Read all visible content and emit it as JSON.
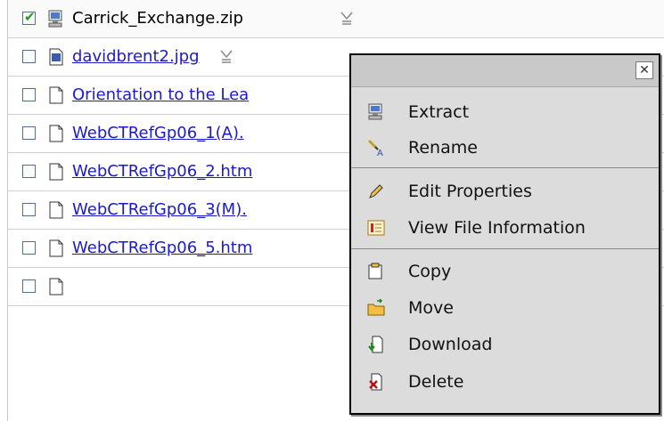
{
  "files": [
    {
      "name": "Carrick_Exchange.zip",
      "icon": "zip-archive-icon",
      "link": false,
      "checked": true
    },
    {
      "name": "davidbrent2.jpg",
      "icon": "image-file-icon",
      "link": true,
      "checked": false
    },
    {
      "name": "Orientation to the Lea",
      "icon": "document-icon",
      "link": true,
      "checked": false
    },
    {
      "name": "WebCTRefGp06_1(A).",
      "icon": "document-icon",
      "link": true,
      "checked": false
    },
    {
      "name": "WebCTRefGp06_2.htm",
      "icon": "document-icon",
      "link": true,
      "checked": false
    },
    {
      "name": "WebCTRefGp06_3(M).",
      "icon": "document-icon",
      "link": true,
      "checked": false
    },
    {
      "name": "WebCTRefGp06_5.htm",
      "icon": "document-icon",
      "link": true,
      "checked": false
    }
  ],
  "context_menu": {
    "close_label": "✕",
    "items": [
      {
        "label": "Extract",
        "icon": "extract-icon"
      },
      {
        "label": "Rename",
        "icon": "rename-icon"
      },
      {
        "label": "Edit Properties",
        "icon": "pencil-icon"
      },
      {
        "label": "View File Information",
        "icon": "info-icon"
      },
      {
        "label": "Copy",
        "icon": "copy-icon"
      },
      {
        "label": "Move",
        "icon": "move-folder-icon"
      },
      {
        "label": "Download",
        "icon": "download-icon"
      },
      {
        "label": "Delete",
        "icon": "delete-icon"
      }
    ]
  },
  "colors": {
    "link": "#1a1acc",
    "menu_bg": "#dcdcdc",
    "checkbox_border": "#4f6f9f",
    "check_mark": "#1c9a1c"
  }
}
